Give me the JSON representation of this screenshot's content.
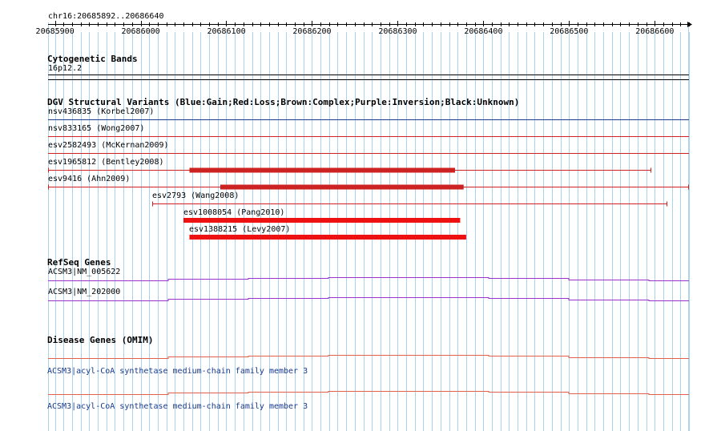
{
  "ruler": {
    "location": "chr16:20685892..20686640",
    "start": 20685892,
    "end": 20686640,
    "ticks": [
      "20685900",
      "20686000",
      "20686100",
      "20686200",
      "20686300",
      "20686400",
      "20686500",
      "20686600"
    ]
  },
  "cytoband": {
    "title": "Cytogenetic Bands",
    "label": "16p12.2"
  },
  "dgv": {
    "title": "DGV Structural Variants (Blue:Gain;Red:Loss;Brown:Complex;Purple:Inversion;Black:Unknown)",
    "tracks": [
      {
        "label": "nsv436835 (Korbel2007)",
        "color": "#1f3a8a",
        "full": true
      },
      {
        "label": "nsv833165 (Wong2007)",
        "color": "#cc2222",
        "full": true
      },
      {
        "label": "esv2582493 (McKernan2009)",
        "color": "#cc2222",
        "full": true
      },
      {
        "label": "esv1965812 (Bentley2008)",
        "color": "#cc2222",
        "full": false,
        "start": 20685892,
        "end": 20686596,
        "thick_start": 20686057,
        "thick_end": 20686367
      },
      {
        "label": "esv9416 (Ahn2009)",
        "color": "#cc2222",
        "full": false,
        "start": 20685892,
        "end": 20686640,
        "thick_start": 20686093,
        "thick_end": 20686377
      },
      {
        "label": "esv2793 (Wang2008)",
        "color": "#cc2222",
        "full": false,
        "start": 20686014,
        "end": 20686615
      },
      {
        "label": "esv1008054 (Pang2010)",
        "color": "#ee1111",
        "full": false,
        "thick_start": 20686050,
        "thick_end": 20686373
      },
      {
        "label": "esv1388215 (Levy2007)",
        "color": "#ee1111",
        "full": false,
        "thick_start": 20686057,
        "thick_end": 20686380
      }
    ]
  },
  "refseq": {
    "title": "RefSeq Genes",
    "genes": [
      {
        "label": "ACSM3|NM_005622",
        "color": "#9933cc"
      },
      {
        "label": "ACSM3|NM_202000",
        "color": "#9933cc"
      }
    ]
  },
  "omim": {
    "title": "Disease Genes (OMIM)",
    "genes": [
      {
        "label": "ACSM3|acyl-CoA synthetase medium-chain family member 3",
        "color": "#e0604a"
      },
      {
        "label": "ACSM3|acyl-CoA synthetase medium-chain family member 3",
        "color": "#e0604a"
      }
    ]
  },
  "colors": {
    "grid": "#a8d4ee",
    "border": "#000000"
  }
}
